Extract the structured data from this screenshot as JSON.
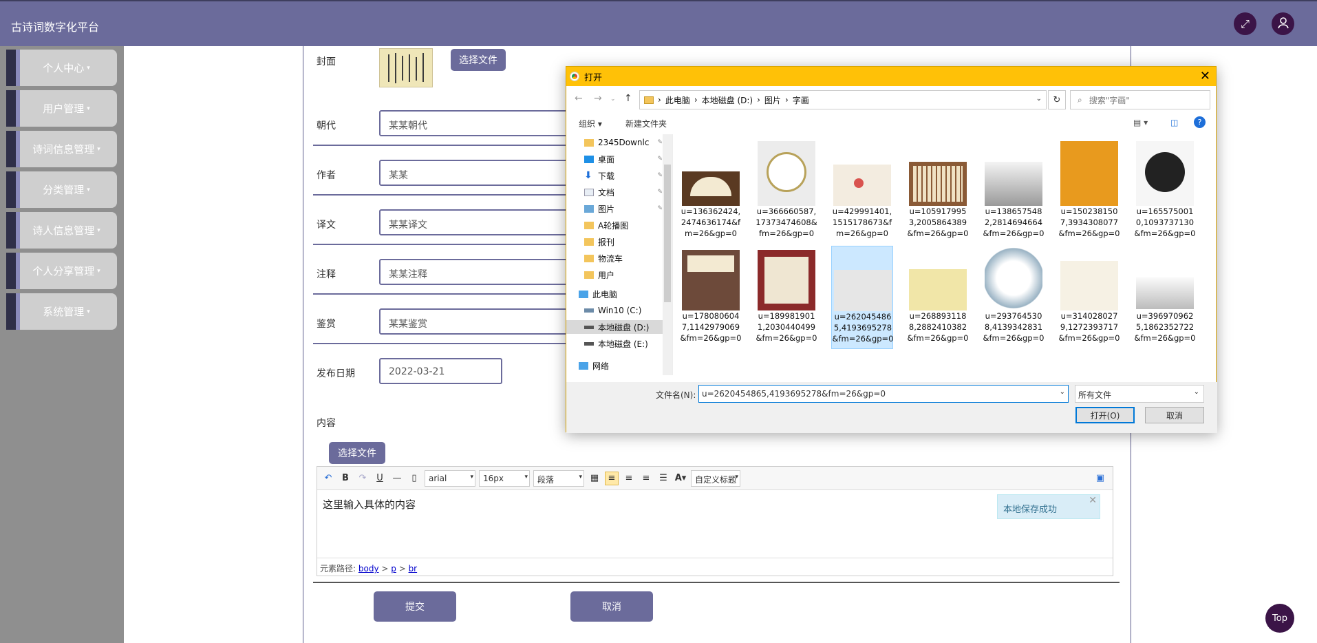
{
  "app": {
    "title": "古诗词数字化平台"
  },
  "sidebar": {
    "items": [
      {
        "label": "个人中心"
      },
      {
        "label": "用户管理"
      },
      {
        "label": "诗词信息管理"
      },
      {
        "label": "分类管理"
      },
      {
        "label": "诗人信息管理"
      },
      {
        "label": "个人分享管理"
      },
      {
        "label": "系统管理"
      }
    ],
    "caret": "▾"
  },
  "form": {
    "cover_label": "封面",
    "choose_file": "选择文件",
    "dynasty_label": "朝代",
    "dynasty_value": "某某朝代",
    "author_label": "作者",
    "author_value": "某某",
    "translation_label": "译文",
    "translation_value": "某某译文",
    "annotation_label": "注释",
    "annotation_value": "某某注释",
    "appreciation_label": "鉴赏",
    "appreciation_value": "某某鉴赏",
    "date_label": "发布日期",
    "date_value": "2022-03-21",
    "content_label": "内容",
    "submit": "提交",
    "cancel": "取消"
  },
  "editor": {
    "font": "arial",
    "size": "16px",
    "para": "段落",
    "custom": "自定义标题",
    "body_text": "这里输入具体的内容",
    "toast": "本地保存成功",
    "path_label": "元素路径:",
    "path": [
      "body",
      "p",
      "br"
    ]
  },
  "top_button": "Top",
  "dialog": {
    "title": "打开",
    "breadcrumb": [
      "此电脑",
      "本地磁盘 (D:)",
      "图片",
      "字画"
    ],
    "search_placeholder": "搜索\"字画\"",
    "organize": "组织 ▾",
    "new_folder": "新建文件夹",
    "tree": [
      {
        "label": "2345Downlc",
        "icon": "folder-icon",
        "pinned": true
      },
      {
        "label": "桌面",
        "icon": "desktop-icon",
        "pinned": true
      },
      {
        "label": "下载",
        "icon": "download-icon",
        "pinned": true
      },
      {
        "label": "文档",
        "icon": "document-icon",
        "pinned": true
      },
      {
        "label": "图片",
        "icon": "picture-icon",
        "pinned": true
      },
      {
        "label": "A轮播图",
        "icon": "folder-icon",
        "pinned": false
      },
      {
        "label": "报刊",
        "icon": "folder-icon",
        "pinned": false
      },
      {
        "label": "物流车",
        "icon": "folder-icon",
        "pinned": false
      },
      {
        "label": "用户",
        "icon": "folder-icon",
        "pinned": false
      },
      {
        "label": "此电脑",
        "icon": "computer-icon",
        "pinned": false
      },
      {
        "label": "Win10 (C:)",
        "icon": "drive-icon",
        "pinned": false
      },
      {
        "label": "本地磁盘 (D:)",
        "icon": "drive-icon",
        "pinned": false
      },
      {
        "label": "本地磁盘 (E:)",
        "icon": "drive-icon",
        "pinned": false
      },
      {
        "label": "网络",
        "icon": "network-icon",
        "pinned": false
      }
    ],
    "files": [
      {
        "name": "u=136362424,2474636174&fm=26&gp=0"
      },
      {
        "name": "u=366660587,17373474608&fm=26&gp=0"
      },
      {
        "name": "u=429991401,1515178673&fm=26&gp=0"
      },
      {
        "name": "u=1059179953,2005864389&fm=26&gp=0"
      },
      {
        "name": "u=1386575482,2814694664&fm=26&gp=0"
      },
      {
        "name": "u=1502381507,3934308077&fm=26&gp=0"
      },
      {
        "name": "u=1655750010,1093737130&fm=26&gp=0"
      },
      {
        "name": "u=1780806047,1142979069&fm=26&gp=0"
      },
      {
        "name": "u=1899819011,2030440499&fm=26&gp=0"
      },
      {
        "name": "u=2620454865,4193695278&fm=26&gp=0"
      },
      {
        "name": "u=2688931188,2882410382&fm=26&gp=0"
      },
      {
        "name": "u=2937645308,4139342831&fm=26&gp=0"
      },
      {
        "name": "u=3140280279,1272393717&fm=26&gp=0"
      },
      {
        "name": "u=3969709625,1862352722&fm=26&gp=0"
      }
    ],
    "filename_label": "文件名(N):",
    "filename_value": "u=2620454865,4193695278&fm=26&gp=0",
    "filetype": "所有文件",
    "open": "打开(O)",
    "cancel": "取消"
  }
}
